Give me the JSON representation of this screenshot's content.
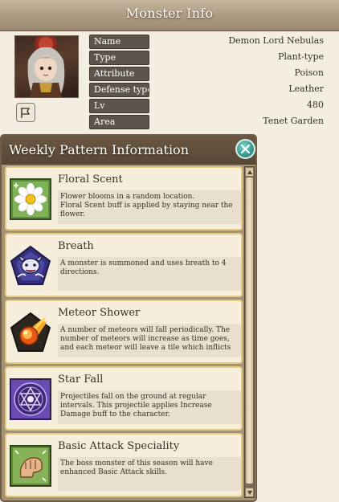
{
  "header": {
    "title": "Monster Info"
  },
  "monster": {
    "portrait_icon": "monster-portrait",
    "fields": [
      {
        "label": "Name",
        "value": "Demon Lord Nebulas"
      },
      {
        "label": "Type",
        "value": "Plant-type"
      },
      {
        "label": "Attribute",
        "value": "Poison"
      },
      {
        "label": "Defense type",
        "value": "Leather"
      },
      {
        "label": "Lv",
        "value": "480"
      },
      {
        "label": "Area",
        "value": "Tenet Garden"
      }
    ]
  },
  "weekly": {
    "title": "Weekly Pattern Information",
    "close_icon": "close-icon",
    "patterns": [
      {
        "icon": "floral-scent-icon",
        "name": "Floral Scent",
        "description": "Flower blooms in a random location.\nFloral Scent buff is applied by staying near the flower."
      },
      {
        "icon": "breath-icon",
        "name": "Breath",
        "description": "A monster is summoned and uses breath to 4 directions."
      },
      {
        "icon": "meteor-shower-icon",
        "name": "Meteor Shower",
        "description": "A number of meteors will fall periodically. The number of meteors will increase as time goes, and each meteor will leave a tile which inflicts"
      },
      {
        "icon": "star-fall-icon",
        "name": "Star Fall",
        "description": "Projectiles fall on the ground at regular intervals. This projectile applies Increase Damage buff to the character."
      },
      {
        "icon": "basic-attack-speciality-icon",
        "name": "Basic Attack Speciality",
        "description": "The boss monster of this season will have enhanced Basic Attack skills."
      }
    ]
  },
  "colors": {
    "label_bg": "#5d554b",
    "panel_bg": "#a59378",
    "card_border": "#e6c982",
    "close_accent": "#3b9e92"
  }
}
